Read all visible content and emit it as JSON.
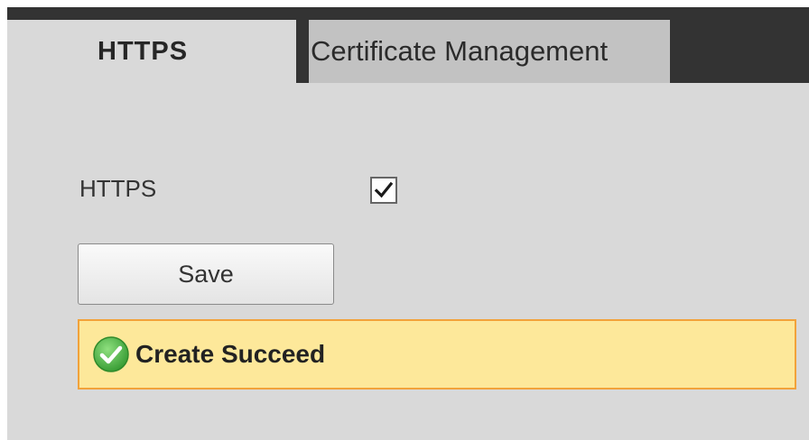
{
  "tabs": [
    {
      "label": "HTTPS",
      "active": true
    },
    {
      "label": "Certificate Management",
      "active": false
    }
  ],
  "form": {
    "https_label": "HTTPS",
    "https_enabled": true,
    "save_label": "Save"
  },
  "notice": {
    "message": "Create Succeed",
    "icon": "success-check-icon"
  },
  "colors": {
    "tab_bar": "#333333",
    "panel": "#d9d9d9",
    "inactive_tab": "#c2c2c2",
    "notice_bg": "#fde89a",
    "notice_border": "#f2a23a",
    "success_green": "#4fb84a"
  }
}
